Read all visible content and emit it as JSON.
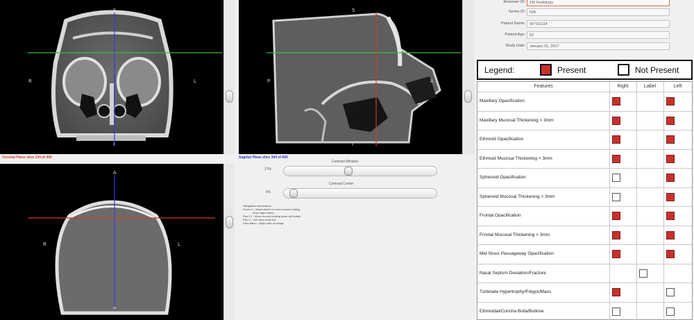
{
  "viewers": {
    "coronal": {
      "orient_top": "S",
      "orient_bottom": "I",
      "orient_left": "R",
      "orient_right": "L",
      "slice_label": "Coronal Plane slice 134 of 400",
      "slice_color": "#d43a2a",
      "crosshair_h": "#34c134",
      "crosshair_v": "#3a3ad4"
    },
    "sagittal": {
      "orient_top": "S",
      "orient_bottom": "I",
      "orient_left": "P",
      "orient_right": "A",
      "slice_label": "Sagittal Plane slice 304 of 600",
      "slice_color": "#2a3ac4",
      "crosshair_h": "#34c134",
      "crosshair_v": "#d43a2a"
    },
    "axial": {
      "orient_top": "A",
      "orient_bottom": "P",
      "orient_left": "R",
      "orient_right": "L",
      "crosshair_h": "#d43a2a",
      "crosshair_v": "#3a3ad4"
    }
  },
  "controls": {
    "contrast_window_label": "Contrast Window",
    "contrast_window_value": "17%",
    "contrast_window_level": 0.42,
    "contrast_center_label": "Contrast Center",
    "contrast_center_value": "5%",
    "contrast_center_level": 0.04,
    "nav_instructions": [
      "Navigation Instructions:",
      "Zoom In - Move wheel or move mouse holding",
      "down right button",
      "Pan XY - Move mouse holding down left button",
      "Pan Z - Use view scroll bar",
      "View Menu - Right click on image"
    ]
  },
  "form": {
    "reviewer_id_label": "Reviewer ID:",
    "reviewer_id_value": "XM Radiology",
    "series_id_label": "Series ID:",
    "series_id_value": "N/A",
    "patient_name_label": "Patient Name:",
    "patient_name_value": "56^011114",
    "patient_age_label": "Patient Age:",
    "patient_age_value": "52",
    "study_date_label": "Study Date:",
    "study_date_value": "January 01, 2017"
  },
  "legend": {
    "title": "Legend:",
    "present_label": "Present",
    "not_present_label": "Not Present",
    "present_color": "#c8312b"
  },
  "features_table": {
    "headers": {
      "features": "Features",
      "right": "Right",
      "label": "Label",
      "left": "Left"
    },
    "rows": [
      {
        "name": "Maxillary Opacification",
        "right": "on",
        "label": "none",
        "left": "on"
      },
      {
        "name": "Maxillary Mucosal Thickening > 3mm",
        "right": "on",
        "label": "none",
        "left": "on"
      },
      {
        "name": "Ethmoid Opacification",
        "right": "on",
        "label": "none",
        "left": "on"
      },
      {
        "name": "Ethmoid Mucosal Thickening > 3mm",
        "right": "on",
        "label": "none",
        "left": "on"
      },
      {
        "name": "Sphenoid Opacification",
        "right": "off",
        "label": "none",
        "left": "on"
      },
      {
        "name": "Sphenoid Mucosal Thickening > 3mm",
        "right": "off",
        "label": "none",
        "left": "on"
      },
      {
        "name": "Frontal Opacification",
        "right": "on",
        "label": "none",
        "left": "on"
      },
      {
        "name": "Frontal Mucosal Thickening > 3mm",
        "right": "on",
        "label": "none",
        "left": "on"
      },
      {
        "name": "Mid-Sinus Passageway Opacification",
        "right": "on",
        "label": "none",
        "left": "on"
      },
      {
        "name": "Nasal Septum Deviation/Fracture",
        "right": "none",
        "label": "off",
        "left": "none"
      },
      {
        "name": "Turbinate Hypertrophy/Polyps/Mass",
        "right": "on",
        "label": "none",
        "left": "off"
      },
      {
        "name": "Ethmoidal/Concha Bulla/Bullose",
        "right": "off",
        "label": "none",
        "left": "off"
      }
    ]
  }
}
